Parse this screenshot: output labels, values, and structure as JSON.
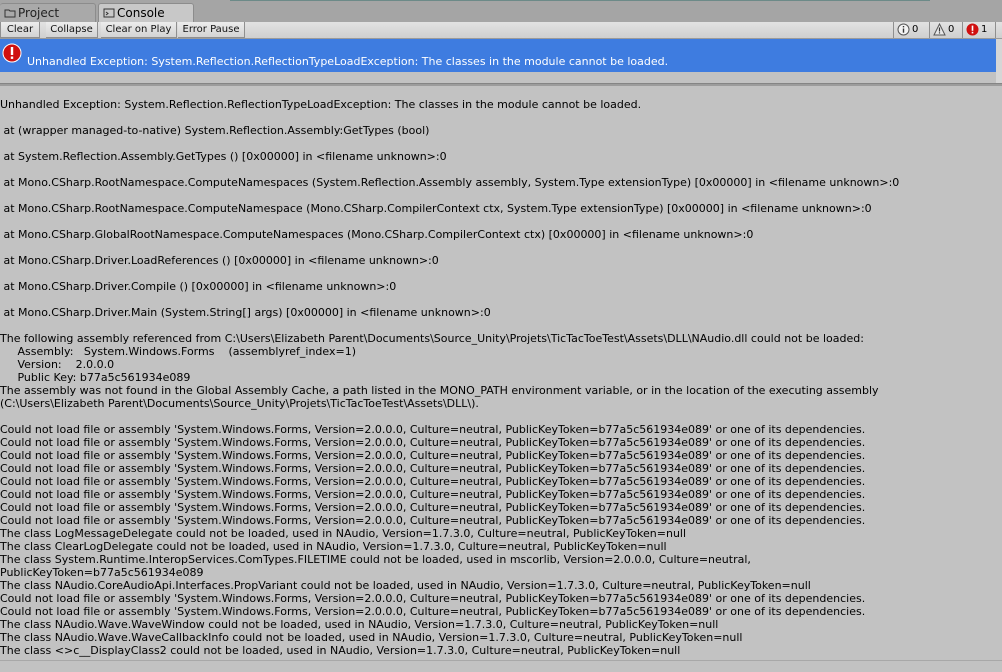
{
  "tabs": [
    {
      "label": "Project",
      "icon": "folder-icon"
    },
    {
      "label": "Console",
      "icon": "console-icon"
    }
  ],
  "toolbar": {
    "clear": "Clear",
    "collapse": "Collapse",
    "clear_on_play": "Clear on Play",
    "error_pause": "Error Pause",
    "info_count": "0",
    "warning_count": "0",
    "error_count": "1"
  },
  "selected_message": "Unhandled Exception: System.Reflection.ReflectionTypeLoadException: The classes in the module cannot be loaded.",
  "detail": {
    "header": "Unhandled Exception: System.Reflection.ReflectionTypeLoadException: The classes in the module cannot be loaded.",
    "stack": [
      " at (wrapper managed-to-native) System.Reflection.Assembly:GetTypes (bool)",
      " at System.Reflection.Assembly.GetTypes () [0x00000] in <filename unknown>:0",
      " at Mono.CSharp.RootNamespace.ComputeNamespaces (System.Reflection.Assembly assembly, System.Type extensionType) [0x00000] in <filename unknown>:0",
      " at Mono.CSharp.RootNamespace.ComputeNamespace (Mono.CSharp.CompilerContext ctx, System.Type extensionType) [0x00000] in <filename unknown>:0",
      " at Mono.CSharp.GlobalRootNamespace.ComputeNamespaces (Mono.CSharp.CompilerContext ctx) [0x00000] in <filename unknown>:0",
      " at Mono.CSharp.Driver.LoadReferences () [0x00000] in <filename unknown>:0",
      " at Mono.CSharp.Driver.Compile () [0x00000] in <filename unknown>:0",
      " at Mono.CSharp.Driver.Main (System.String[] args) [0x00000] in <filename unknown>:0"
    ],
    "assembly_block": [
      "The following assembly referenced from C:\\Users\\Elizabeth Parent\\Documents\\Source_Unity\\Projets\\TicTacToeTest\\Assets\\DLL\\NAudio.dll could not be loaded:",
      "     Assembly:   System.Windows.Forms    (assemblyref_index=1)",
      "     Version:    2.0.0.0",
      "     Public Key: b77a5c561934e089",
      "The assembly was not found in the Global Assembly Cache, a path listed in the MONO_PATH environment variable, or in the location of the executing assembly",
      "(C:\\Users\\Elizabeth Parent\\Documents\\Source_Unity\\Projets\\TicTacToeTest\\Assets\\DLL\\)."
    ],
    "load_errors": [
      "Could not load file or assembly 'System.Windows.Forms, Version=2.0.0.0, Culture=neutral, PublicKeyToken=b77a5c561934e089' or one of its dependencies.",
      "Could not load file or assembly 'System.Windows.Forms, Version=2.0.0.0, Culture=neutral, PublicKeyToken=b77a5c561934e089' or one of its dependencies.",
      "Could not load file or assembly 'System.Windows.Forms, Version=2.0.0.0, Culture=neutral, PublicKeyToken=b77a5c561934e089' or one of its dependencies.",
      "Could not load file or assembly 'System.Windows.Forms, Version=2.0.0.0, Culture=neutral, PublicKeyToken=b77a5c561934e089' or one of its dependencies.",
      "Could not load file or assembly 'System.Windows.Forms, Version=2.0.0.0, Culture=neutral, PublicKeyToken=b77a5c561934e089' or one of its dependencies.",
      "Could not load file or assembly 'System.Windows.Forms, Version=2.0.0.0, Culture=neutral, PublicKeyToken=b77a5c561934e089' or one of its dependencies.",
      "Could not load file or assembly 'System.Windows.Forms, Version=2.0.0.0, Culture=neutral, PublicKeyToken=b77a5c561934e089' or one of its dependencies.",
      "Could not load file or assembly 'System.Windows.Forms, Version=2.0.0.0, Culture=neutral, PublicKeyToken=b77a5c561934e089' or one of its dependencies.",
      "The class LogMessageDelegate could not be loaded, used in NAudio, Version=1.7.3.0, Culture=neutral, PublicKeyToken=null",
      "The class ClearLogDelegate could not be loaded, used in NAudio, Version=1.7.3.0, Culture=neutral, PublicKeyToken=null",
      "The class System.Runtime.InteropServices.ComTypes.FILETIME could not be loaded, used in mscorlib, Version=2.0.0.0, Culture=neutral,",
      "PublicKeyToken=b77a5c561934e089",
      "The class NAudio.CoreAudioApi.Interfaces.PropVariant could not be loaded, used in NAudio, Version=1.7.3.0, Culture=neutral, PublicKeyToken=null",
      "Could not load file or assembly 'System.Windows.Forms, Version=2.0.0.0, Culture=neutral, PublicKeyToken=b77a5c561934e089' or one of its dependencies.",
      "Could not load file or assembly 'System.Windows.Forms, Version=2.0.0.0, Culture=neutral, PublicKeyToken=b77a5c561934e089' or one of its dependencies.",
      "The class NAudio.Wave.WaveWindow could not be loaded, used in NAudio, Version=1.7.3.0, Culture=neutral, PublicKeyToken=null",
      "The class NAudio.Wave.WaveCallbackInfo could not be loaded, used in NAudio, Version=1.7.3.0, Culture=neutral, PublicKeyToken=null",
      "The class <>c__DisplayClass2 could not be loaded, used in NAudio, Version=1.7.3.0, Culture=neutral, PublicKeyToken=null"
    ]
  },
  "colors": {
    "selection": "#3e7ce0",
    "background": "#c2c2c2",
    "error_red": "#d01010"
  }
}
